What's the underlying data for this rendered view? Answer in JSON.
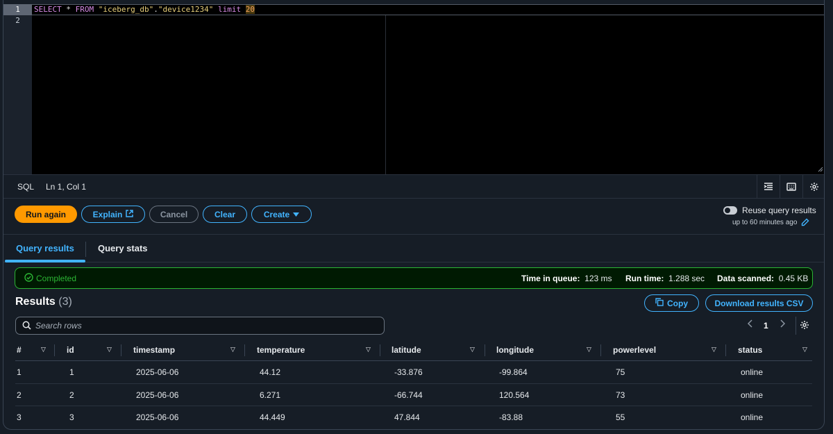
{
  "editor": {
    "line_numbers": [
      "1",
      "2"
    ],
    "tokens": {
      "kw_select": "SELECT",
      "star": "*",
      "kw_from": "FROM",
      "db": "\"iceberg_db\"",
      "dot": ".",
      "table": "\"device1234\"",
      "kw_limit": "limit",
      "limit_value": "20"
    }
  },
  "statusbar": {
    "language": "SQL",
    "cursor": "Ln 1, Col 1"
  },
  "actions": {
    "run_again": "Run again",
    "explain": "Explain",
    "cancel": "Cancel",
    "clear": "Clear",
    "create": "Create",
    "reuse_label": "Reuse query results",
    "reuse_sub": "up to 60 minutes ago"
  },
  "tabs": [
    {
      "label": "Query results"
    },
    {
      "label": "Query stats"
    }
  ],
  "banner": {
    "status": "Completed",
    "queue_label": "Time in queue:",
    "queue_value": "123 ms",
    "runtime_label": "Run time:",
    "runtime_value": "1.288 sec",
    "scanned_label": "Data scanned:",
    "scanned_value": "0.45 KB"
  },
  "results": {
    "title": "Results",
    "count": "(3)",
    "copy": "Copy",
    "download": "Download results CSV",
    "search_placeholder": "Search rows",
    "page": "1"
  },
  "table": {
    "columns": [
      "#",
      "id",
      "timestamp",
      "temperature",
      "latitude",
      "longitude",
      "powerlevel",
      "status"
    ],
    "rows": [
      [
        "1",
        "1",
        "2025-06-06",
        "44.12",
        "-33.876",
        "-99.864",
        "75",
        "online"
      ],
      [
        "2",
        "2",
        "2025-06-06",
        "6.271",
        "-66.744",
        "120.564",
        "73",
        "online"
      ],
      [
        "3",
        "3",
        "2025-06-06",
        "44.449",
        "47.844",
        "-83.88",
        "55",
        "online"
      ]
    ]
  },
  "colors": {
    "accent": "#42b4ff",
    "primary": "#ff9900",
    "success": "#2bb534",
    "background": "#161d26"
  }
}
